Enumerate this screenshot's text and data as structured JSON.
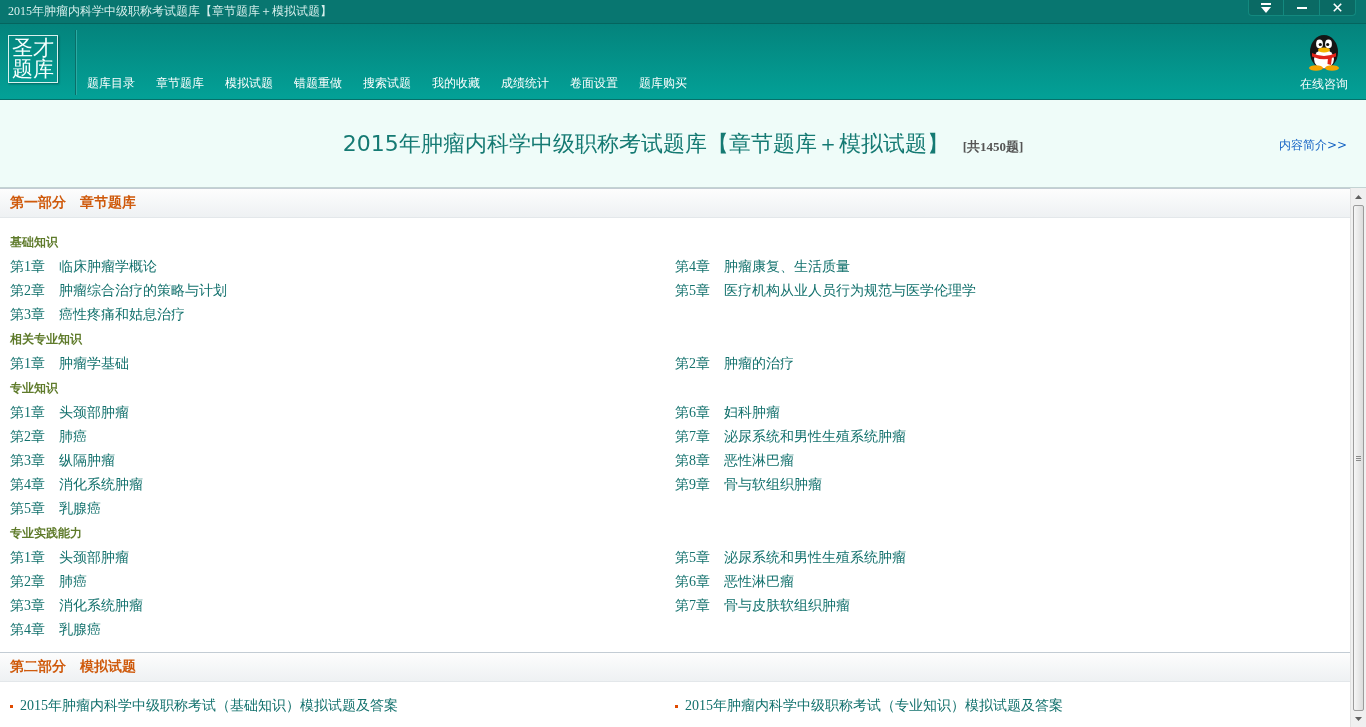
{
  "window": {
    "title": "2015年肿瘤内科学中级职称考试题库【章节题库＋模拟试题】"
  },
  "navbar": {
    "logo": "圣才题库",
    "items": [
      {
        "label": "题库目录"
      },
      {
        "label": "章节题库"
      },
      {
        "label": "模拟试题"
      },
      {
        "label": "错题重做"
      },
      {
        "label": "搜索试题"
      },
      {
        "label": "我的收藏"
      },
      {
        "label": "成绩统计"
      },
      {
        "label": "卷面设置"
      },
      {
        "label": "题库购买"
      }
    ],
    "consult": "在线咨询"
  },
  "header": {
    "title": "2015年肿瘤内科学中级职称考试题库【章节题库＋模拟试题】",
    "count": "[共1450题]",
    "link": "内容简介>>"
  },
  "sections": [
    {
      "kind": "chapters",
      "title": "第一部分　章节题库",
      "groups": [
        {
          "title": "基础知识",
          "columns": [
            [
              "第1章　临床肿瘤学概论",
              "第2章　肿瘤综合治疗的策略与计划",
              "第3章　癌性疼痛和姑息治疗"
            ],
            [
              "第4章　肿瘤康复、生活质量",
              "第5章　医疗机构从业人员行为规范与医学伦理学"
            ]
          ]
        },
        {
          "title": "相关专业知识",
          "columns": [
            [
              "第1章　肿瘤学基础"
            ],
            [
              "第2章　肿瘤的治疗"
            ]
          ]
        },
        {
          "title": "专业知识",
          "columns": [
            [
              "第1章　头颈部肿瘤",
              "第2章　肺癌",
              "第3章　纵隔肿瘤",
              "第4章　消化系统肿瘤",
              "第5章　乳腺癌"
            ],
            [
              "第6章　妇科肿瘤",
              "第7章　泌尿系统和男性生殖系统肿瘤",
              "第8章　恶性淋巴瘤",
              "第9章　骨与软组织肿瘤"
            ]
          ]
        },
        {
          "title": "专业实践能力",
          "columns": [
            [
              "第1章　头颈部肿瘤",
              "第2章　肺癌",
              "第3章　消化系统肿瘤",
              "第4章　乳腺癌"
            ],
            [
              "第5章　泌尿系统和男性生殖系统肿瘤",
              "第6章　恶性淋巴瘤",
              "第7章　骨与皮肤软组织肿瘤"
            ]
          ]
        }
      ]
    },
    {
      "kind": "papers",
      "title": "第二部分　模拟试题",
      "columns": [
        [
          "2015年肿瘤内科学中级职称考试（基础知识）模拟试题及答案"
        ],
        [
          "2015年肿瘤内科学中级职称考试（专业知识）模拟试题及答案"
        ]
      ]
    }
  ]
}
